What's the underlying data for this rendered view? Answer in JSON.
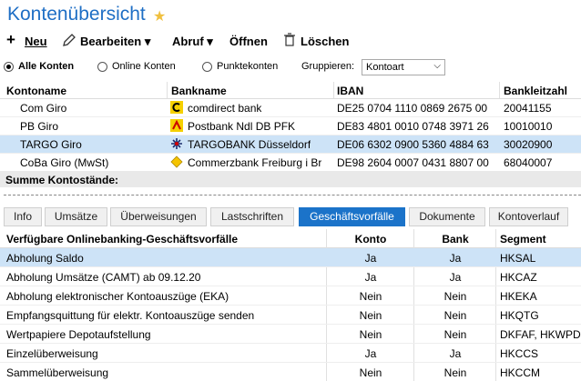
{
  "header": {
    "title": "Kontenübersicht"
  },
  "toolbar": {
    "new_label": "Neu",
    "edit_label": "Bearbeiten",
    "fetch_label": "Abruf",
    "open_label": "Öffnen",
    "delete_label": "Löschen"
  },
  "filters": {
    "all_accounts": "Alle Konten",
    "online_accounts": "Online Konten",
    "point_accounts": "Punktekonten",
    "group_label": "Gruppieren:",
    "group_value": "Kontoart"
  },
  "accounts": {
    "headers": [
      "Kontoname",
      "Bankname",
      "IBAN",
      "Bankleitzahl"
    ],
    "rows": [
      {
        "name": "Com Giro",
        "bank": "comdirect bank",
        "iban": "DE25 0704 1110 0869 2675 00",
        "blz": "20041155",
        "icon": "comdirect-icon"
      },
      {
        "name": "PB Giro",
        "bank": "Postbank Ndl DB PFK",
        "iban": "DE83 4801 0010 0748 3971 26",
        "blz": "10010010",
        "icon": "postbank-icon"
      },
      {
        "name": "TARGO Giro",
        "bank": "TARGOBANK Düsseldorf",
        "iban": "DE06 6302 0900 5360 4884 63",
        "blz": "30020900",
        "icon": "targobank-icon"
      },
      {
        "name": "CoBa Giro (MwSt)",
        "bank": "Commerzbank Freiburg i Br",
        "iban": "DE98 2604 0007 0431 8807 00",
        "blz": "68040007",
        "icon": "commerzbank-icon"
      }
    ]
  },
  "summary": {
    "label": "Summe Kontostände:"
  },
  "tabs": [
    "Info",
    "Umsätze",
    "Überweisungen",
    "Lastschriften",
    "Geschäftsvorfälle",
    "Dokumente",
    "Kontoverlauf"
  ],
  "operations": {
    "headers": [
      "Verfügbare Onlinebanking-Geschäftsvorfälle",
      "Konto",
      "Bank",
      "Segment"
    ],
    "rows": [
      {
        "name": "Abholung Saldo",
        "konto": "Ja",
        "bank": "Ja",
        "segment": "HKSAL"
      },
      {
        "name": "Abholung Umsätze (CAMT) ab 09.12.20",
        "konto": "Ja",
        "bank": "Ja",
        "segment": "HKCAZ"
      },
      {
        "name": "Abholung elektronischer Kontoauszüge (EKA)",
        "konto": "Nein",
        "bank": "Nein",
        "segment": "HKEKA"
      },
      {
        "name": "Empfangsquittung für elektr. Kontoauszüge senden",
        "konto": "Nein",
        "bank": "Nein",
        "segment": "HKQTG"
      },
      {
        "name": "Wertpapiere Depotaufstellung",
        "konto": "Nein",
        "bank": "Nein",
        "segment": "DKFAF, HKWPD"
      },
      {
        "name": "Einzelüberweisung",
        "konto": "Ja",
        "bank": "Ja",
        "segment": "HKCCS"
      },
      {
        "name": "Sammelüberweisung",
        "konto": "Nein",
        "bank": "Nein",
        "segment": "HKCCM"
      }
    ]
  },
  "colors": {
    "accent": "#1b73c9",
    "selection": "#cde3f7",
    "title": "#1f6fc5"
  }
}
